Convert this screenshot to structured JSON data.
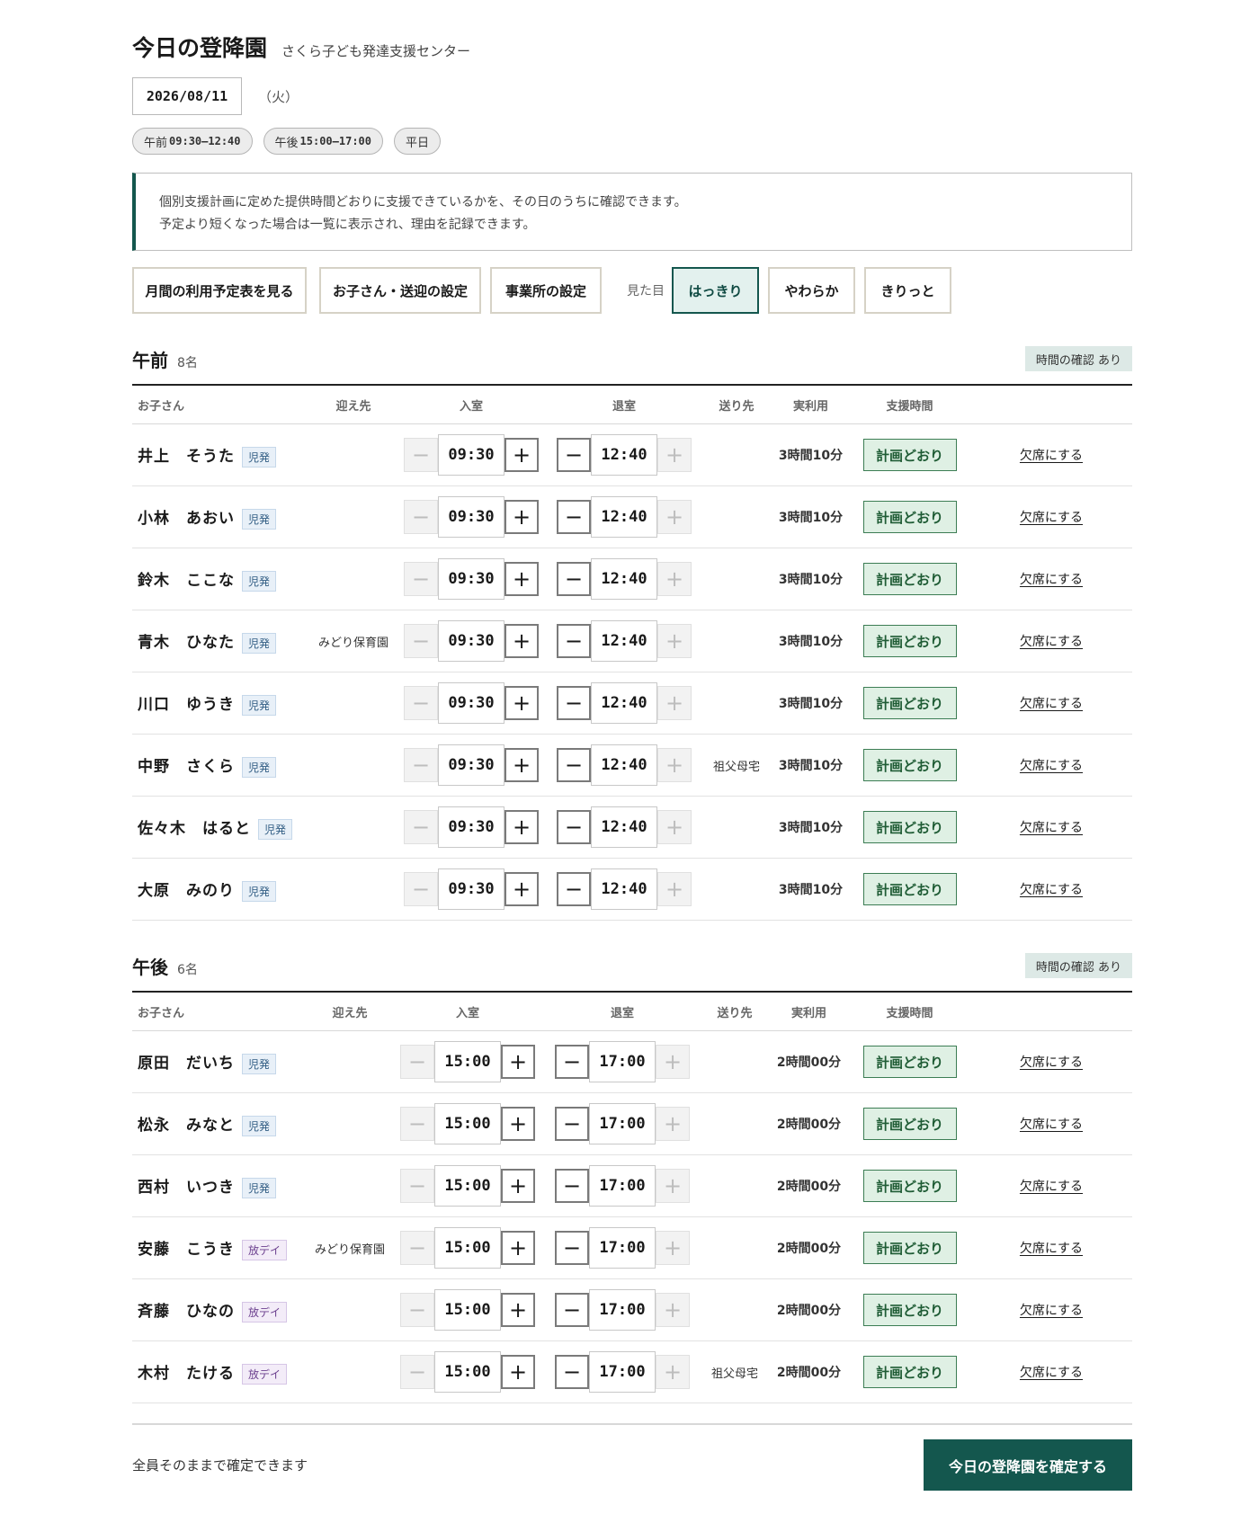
{
  "header": {
    "title": "今日の登降園",
    "subtitle": "さくら子ども発達支援センター"
  },
  "date": {
    "value": "2026/08/11",
    "weekday": "（火）"
  },
  "chips": [
    {
      "label": "午前",
      "time": "09:30–12:40"
    },
    {
      "label": "午後",
      "time": "15:00–17:00"
    },
    {
      "label": "平日",
      "time": ""
    }
  ],
  "notice": {
    "line1": "個別支援計画に定めた提供時間どおりに支援できているかを、その日のうちに確認できます。",
    "line2": "予定より短くなった場合は一覧に表示され、理由を記録できます。"
  },
  "toolbar": {
    "monthly": "月間の利用予定表を見る",
    "settings_child": "お子さん・送迎の設定",
    "settings_office": "事業所の設定",
    "look_label": "見た目",
    "look_options": [
      "はっきり",
      "やわらか",
      "きりっと"
    ],
    "look_selected": "はっきり"
  },
  "columns": {
    "child": "お子さん",
    "pickup": "迎え先",
    "in": "入室",
    "out": "退室",
    "dropoff": "送り先",
    "actual": "実利用",
    "support": "支援時間"
  },
  "stepper": {
    "minus": "−",
    "plus": "+"
  },
  "status_label": "計画どおり",
  "absent_label": "欠席にする",
  "sessions": {
    "am": {
      "title": "午前",
      "count": "8名",
      "badge": "時間の確認 あり",
      "rows": [
        {
          "name": "井上　そうた",
          "tag": "児発",
          "pickup": "",
          "in": "09:30",
          "out": "12:40",
          "dropoff": "",
          "actual": "3時間10分"
        },
        {
          "name": "小林　あおい",
          "tag": "児発",
          "pickup": "",
          "in": "09:30",
          "out": "12:40",
          "dropoff": "",
          "actual": "3時間10分"
        },
        {
          "name": "鈴木　ここな",
          "tag": "児発",
          "pickup": "",
          "in": "09:30",
          "out": "12:40",
          "dropoff": "",
          "actual": "3時間10分"
        },
        {
          "name": "青木　ひなた",
          "tag": "児発",
          "pickup": "みどり保育園",
          "in": "09:30",
          "out": "12:40",
          "dropoff": "",
          "actual": "3時間10分"
        },
        {
          "name": "川口　ゆうき",
          "tag": "児発",
          "pickup": "",
          "in": "09:30",
          "out": "12:40",
          "dropoff": "",
          "actual": "3時間10分"
        },
        {
          "name": "中野　さくら",
          "tag": "児発",
          "pickup": "",
          "in": "09:30",
          "out": "12:40",
          "dropoff": "祖父母宅",
          "actual": "3時間10分"
        },
        {
          "name": "佐々木　はると",
          "tag": "児発",
          "pickup": "",
          "in": "09:30",
          "out": "12:40",
          "dropoff": "",
          "actual": "3時間10分"
        },
        {
          "name": "大原　みのり",
          "tag": "児発",
          "pickup": "",
          "in": "09:30",
          "out": "12:40",
          "dropoff": "",
          "actual": "3時間10分"
        }
      ]
    },
    "pm": {
      "title": "午後",
      "count": "6名",
      "badge": "時間の確認 あり",
      "rows": [
        {
          "name": "原田　だいち",
          "tag": "児発",
          "pickup": "",
          "in": "15:00",
          "out": "17:00",
          "dropoff": "",
          "actual": "2時間00分"
        },
        {
          "name": "松永　みなと",
          "tag": "児発",
          "pickup": "",
          "in": "15:00",
          "out": "17:00",
          "dropoff": "",
          "actual": "2時間00分"
        },
        {
          "name": "西村　いつき",
          "tag": "児発",
          "pickup": "",
          "in": "15:00",
          "out": "17:00",
          "dropoff": "",
          "actual": "2時間00分"
        },
        {
          "name": "安藤　こうき",
          "tag": "放デイ",
          "pickup": "みどり保育園",
          "in": "15:00",
          "out": "17:00",
          "dropoff": "",
          "actual": "2時間00分"
        },
        {
          "name": "斉藤　ひなの",
          "tag": "放デイ",
          "pickup": "",
          "in": "15:00",
          "out": "17:00",
          "dropoff": "",
          "actual": "2時間00分"
        },
        {
          "name": "木村　たける",
          "tag": "放デイ",
          "pickup": "",
          "in": "15:00",
          "out": "17:00",
          "dropoff": "祖父母宅",
          "actual": "2時間00分"
        }
      ]
    }
  },
  "footer": {
    "note": "全員そのままで確定できます",
    "confirm": "今日の登降園を確定する"
  },
  "colors": {
    "brand": "#14574e",
    "status_bg": "#dff0e4",
    "tag_jihatsu": "#e8f0f8",
    "tag_houday": "#f3ecf8"
  }
}
